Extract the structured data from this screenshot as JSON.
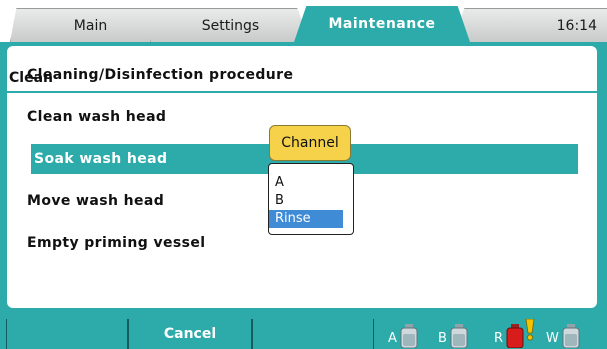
{
  "tabs": [
    {
      "label": "Main",
      "active": false
    },
    {
      "label": "Settings",
      "active": false
    },
    {
      "label": "Maintenance",
      "active": true
    }
  ],
  "clock": "16:14",
  "panel": {
    "title": "Clean",
    "items": [
      {
        "label": "Cleaning/Disinfection procedure",
        "selected": false
      },
      {
        "label": "Clean wash head",
        "selected": false
      },
      {
        "label": "Soak wash head",
        "selected": true
      },
      {
        "label": "Move wash head",
        "selected": false
      },
      {
        "label": "Empty priming vessel",
        "selected": false
      }
    ]
  },
  "channel_popup": {
    "label": "Channel",
    "options": [
      "A",
      "B",
      "Rinse"
    ],
    "selected": "Rinse"
  },
  "bottom_bar": {
    "button_1": "",
    "button_2": "Cancel",
    "button_3": ""
  },
  "bottles": [
    {
      "label": "A",
      "color": "#cfd8dc",
      "alert": false
    },
    {
      "label": "B",
      "color": "#cfd8dc",
      "alert": false
    },
    {
      "label": "R",
      "color": "#d81b1b",
      "alert": true
    },
    {
      "label": "W",
      "color": "#cfd8dc",
      "alert": false
    }
  ],
  "colors": {
    "accent": "#2cabaa",
    "popup_label": "#f6d24a",
    "selection": "#3f8bd6",
    "alert": "#f2c400"
  }
}
